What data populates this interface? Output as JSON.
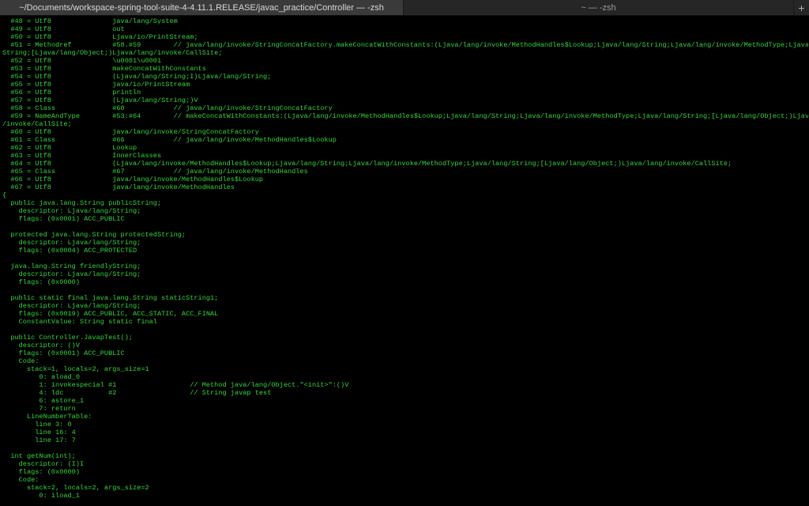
{
  "tabs": [
    {
      "label": "~/Documents/workspace-spring-tool-suite-4-4.11.1.RELEASE/javac_practice/Controller — -zsh",
      "active": true
    },
    {
      "label": "~ — -zsh",
      "active": false
    }
  ],
  "new_tab_label": "+",
  "colors": {
    "text": "#35d63c",
    "background": "#000000",
    "tabbar": "#2a2a2a"
  },
  "terminal_lines": [
    "  #48 = Utf8               java/lang/System",
    "  #49 = Utf8               out",
    "  #50 = Utf8               Ljava/io/PrintStream;",
    "  #51 = Methodref          #58.#59        // java/lang/invoke/StringConcatFactory.makeConcatWithConstants:(Ljava/lang/invoke/MethodHandles$Lookup;Ljava/lang/String;Ljava/lang/invoke/MethodType;Ljava/lang/",
    "String;[Ljava/lang/Object;)Ljava/lang/invoke/CallSite;",
    "  #52 = Utf8               \\u0001\\u0001",
    "  #53 = Utf8               makeConcatWithConstants",
    "  #54 = Utf8               (Ljava/lang/String;I)Ljava/lang/String;",
    "  #55 = Utf8               java/io/PrintStream",
    "  #56 = Utf8               println",
    "  #57 = Utf8               (Ljava/lang/String;)V",
    "  #58 = Class              #60            // java/lang/invoke/StringConcatFactory",
    "  #59 = NameAndType        #53:#64        // makeConcatWithConstants:(Ljava/lang/invoke/MethodHandles$Lookup;Ljava/lang/String;Ljava/lang/invoke/MethodType;Ljava/lang/String;[Ljava/lang/Object;)Ljava/lang",
    "/invoke/CallSite;",
    "  #60 = Utf8               java/lang/invoke/StringConcatFactory",
    "  #61 = Class              #66            // java/lang/invoke/MethodHandles$Lookup",
    "  #62 = Utf8               Lookup",
    "  #63 = Utf8               InnerClasses",
    "  #64 = Utf8               (Ljava/lang/invoke/MethodHandles$Lookup;Ljava/lang/String;Ljava/lang/invoke/MethodType;Ljava/lang/String;[Ljava/lang/Object;)Ljava/lang/invoke/CallSite;",
    "  #65 = Class              #67            // java/lang/invoke/MethodHandles",
    "  #66 = Utf8               java/lang/invoke/MethodHandles$Lookup",
    "  #67 = Utf8               java/lang/invoke/MethodHandles",
    "{",
    "  public java.lang.String publicString;",
    "    descriptor: Ljava/lang/String;",
    "    flags: (0x0001) ACC_PUBLIC",
    "",
    "  protected java.lang.String protectedString;",
    "    descriptor: Ljava/lang/String;",
    "    flags: (0x0004) ACC_PROTECTED",
    "",
    "  java.lang.String friendlyString;",
    "    descriptor: Ljava/lang/String;",
    "    flags: (0x0000)",
    "",
    "  public static final java.lang.String staticString1;",
    "    descriptor: Ljava/lang/String;",
    "    flags: (0x0019) ACC_PUBLIC, ACC_STATIC, ACC_FINAL",
    "    ConstantValue: String static final",
    "",
    "  public Controller.JavapTest();",
    "    descriptor: ()V",
    "    flags: (0x0001) ACC_PUBLIC",
    "    Code:",
    "      stack=1, locals=2, args_size=1",
    "         0: aload_0",
    "         1: invokespecial #1                  // Method java/lang/Object.\"<init>\":()V",
    "         4: ldc           #2                  // String javap test",
    "         6: astore_1",
    "         7: return",
    "      LineNumberTable:",
    "        line 3: 0",
    "        line 16: 4",
    "        line 17: 7",
    "",
    "  int getNum(int);",
    "    descriptor: (I)I",
    "    flags: (0x0000)",
    "    Code:",
    "      stack=2, locals=2, args_size=2",
    "         0: iload_1"
  ]
}
